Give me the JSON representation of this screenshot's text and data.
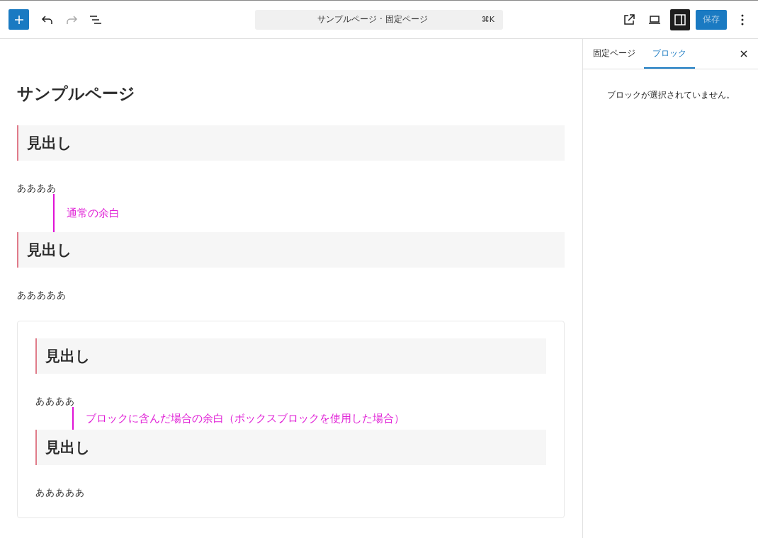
{
  "toolbar": {
    "redo_disabled": true,
    "sidebar_pressed": true,
    "save": {
      "label": "保存",
      "disabled": true
    }
  },
  "command_bar": {
    "title": "サンプルページ · 固定ページ",
    "shortcut": "⌘K"
  },
  "editor": {
    "title": "サンプルページ",
    "blocks": [
      {
        "kind": "heading",
        "text": "見出し"
      },
      {
        "kind": "paragraph",
        "text": "ああああ"
      },
      {
        "kind": "annotation",
        "text": "通常の余白"
      },
      {
        "kind": "heading",
        "text": "見出し"
      },
      {
        "kind": "paragraph",
        "text": "あああああ"
      },
      {
        "kind": "box",
        "children": [
          {
            "kind": "heading",
            "text": "見出し"
          },
          {
            "kind": "paragraph",
            "text": "ああああ"
          },
          {
            "kind": "annotation",
            "text": "ブロックに含んだ場合の余白（ボックスブロックを使用した場合）"
          },
          {
            "kind": "heading",
            "text": "見出し"
          },
          {
            "kind": "paragraph",
            "text": "あああああ"
          }
        ]
      }
    ]
  },
  "sidebar": {
    "tabs": [
      {
        "label": "固定ページ",
        "selected": false
      },
      {
        "label": "ブロック",
        "selected": true
      }
    ],
    "message": "ブロックが選択されていません。"
  }
}
